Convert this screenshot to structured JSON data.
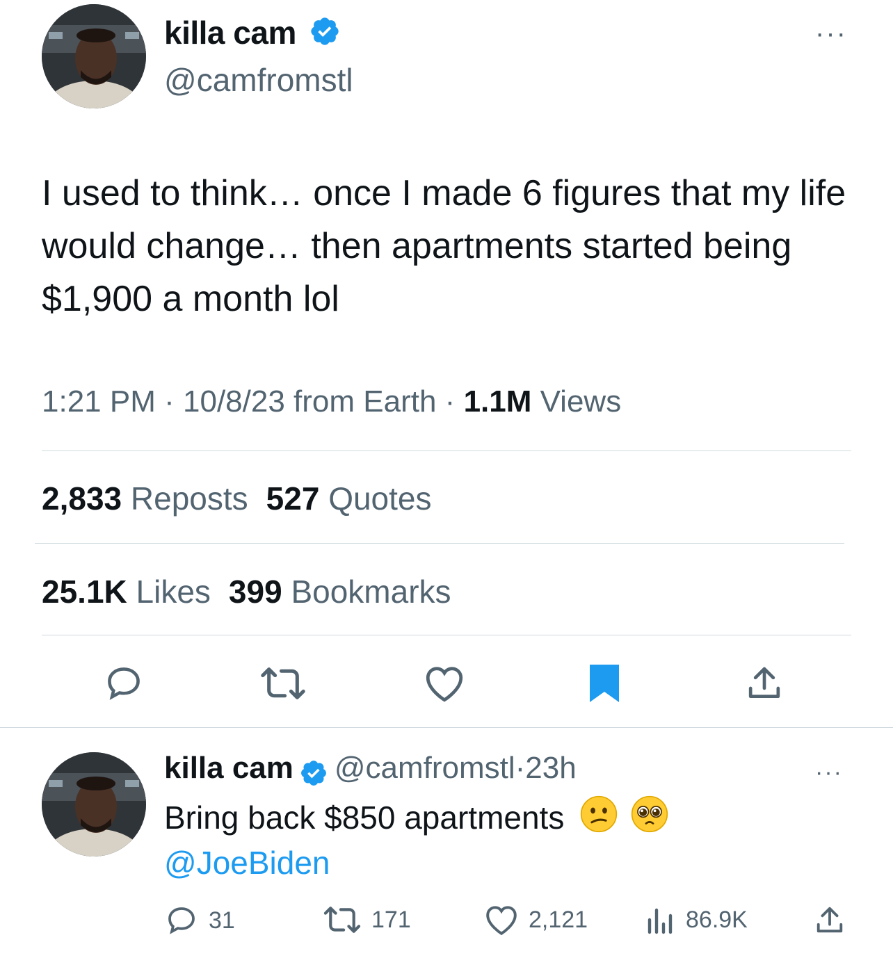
{
  "main_tweet": {
    "display_name": "killa cam",
    "handle": "@camfromstl",
    "text": "I used to think… once I made 6 figures that my life would change… then apartments started being $1,900 a month lol",
    "time": "1:21 PM",
    "sep1": "·",
    "date": "10/8/23",
    "source": "from Earth",
    "sep2": "·",
    "views_count": "1.1M",
    "views_label": "Views",
    "reposts_count": "2,833",
    "reposts_label": "Reposts",
    "quotes_count": "527",
    "quotes_label": "Quotes",
    "likes_count": "25.1K",
    "likes_label": "Likes",
    "bookmarks_count": "399",
    "bookmarks_label": "Bookmarks",
    "more_label": "···",
    "icons": [
      "reply-icon",
      "repost-icon",
      "like-icon",
      "bookmark-filled-icon",
      "share-icon"
    ]
  },
  "reply": {
    "display_name": "killa cam",
    "handle": "@camfromstl",
    "sep": "·",
    "age": "23h",
    "text": "Bring back $850 apartments",
    "mention": "@JoeBiden",
    "emojis": [
      "confused-face-emoji",
      "pleading-face-emoji"
    ],
    "more_label": "···",
    "replies": "31",
    "reposts": "171",
    "likes": "2,121",
    "views": "86.9K"
  },
  "colors": {
    "text": "#0f1419",
    "secondary": "#536471",
    "accent": "#1d9bf0",
    "divider": "#cfd9de"
  }
}
